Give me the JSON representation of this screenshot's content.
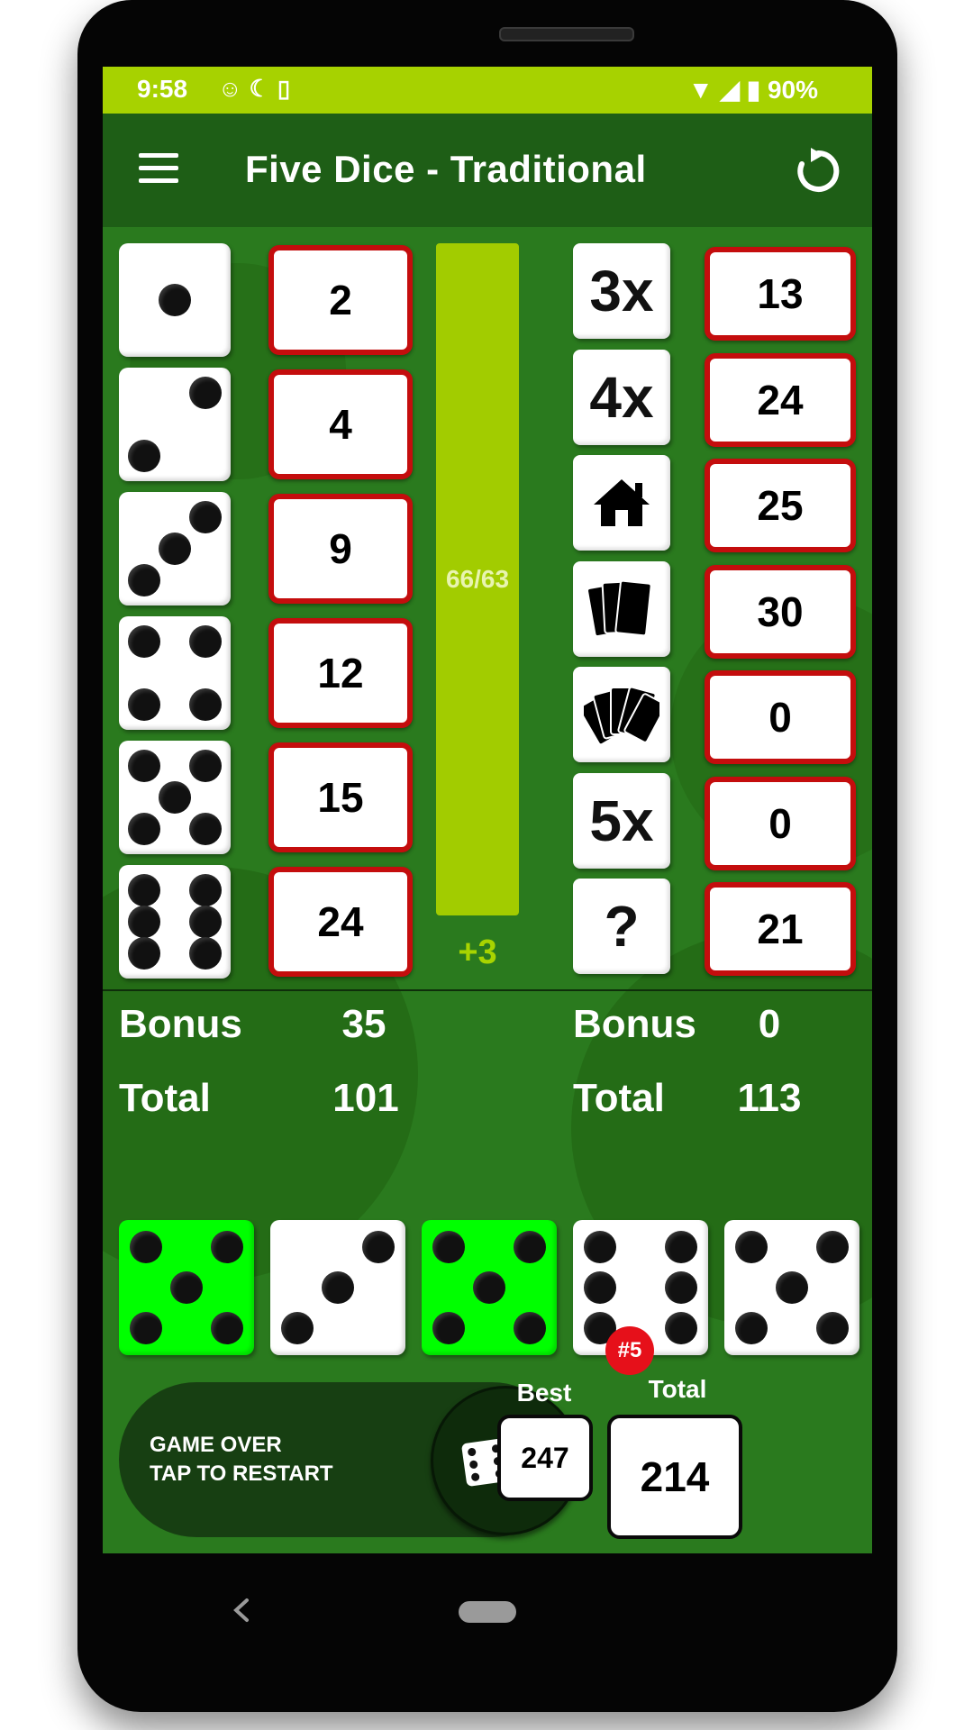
{
  "status_bar": {
    "time": "9:58",
    "icons": [
      "android-head-icon",
      "moon-icon",
      "cast-icon"
    ],
    "battery": "90%",
    "colors": {
      "background": "#a7d200"
    }
  },
  "app_bar": {
    "title": "Five Dice - Traditional",
    "colors": {
      "background": "#1e5e16"
    }
  },
  "upper_section": {
    "rows": [
      {
        "face": 1,
        "score": "2"
      },
      {
        "face": 2,
        "score": "4"
      },
      {
        "face": 3,
        "score": "9"
      },
      {
        "face": 4,
        "score": "12"
      },
      {
        "face": 5,
        "score": "15"
      },
      {
        "face": 6,
        "score": "24"
      }
    ],
    "progress_label": "66/63",
    "progress_fraction": 1.0,
    "bonus_delta": "+3",
    "bonus_label": "Bonus",
    "bonus_value": "35",
    "total_label": "Total",
    "total_value": "101"
  },
  "lower_section": {
    "rows": [
      {
        "label": "3x",
        "icon": "",
        "score": "13"
      },
      {
        "label": "4x",
        "icon": "",
        "score": "24"
      },
      {
        "label": "",
        "icon": "house-icon",
        "score": "25"
      },
      {
        "label": "",
        "icon": "four-cards-icon",
        "score": "30"
      },
      {
        "label": "",
        "icon": "five-cards-icon",
        "score": "0"
      },
      {
        "label": "5x",
        "icon": "",
        "score": "0"
      },
      {
        "label": "?",
        "icon": "",
        "score": "21"
      }
    ],
    "bonus_label": "Bonus",
    "bonus_value": "0",
    "total_label": "Total",
    "total_value": "113"
  },
  "rolled_dice": [
    {
      "face": 5,
      "held": true
    },
    {
      "face": 3,
      "held": false
    },
    {
      "face": 5,
      "held": true
    },
    {
      "face": 6,
      "held": false
    },
    {
      "face": 5,
      "held": false
    }
  ],
  "controls": {
    "status_line1": "GAME OVER",
    "status_line2": "TAP TO RESTART",
    "best_label": "Best",
    "best_value": "247",
    "total_label": "Total",
    "total_value": "214",
    "rank_badge": "#5"
  },
  "colors": {
    "board": "#2a7a1e",
    "held_die": "#00ff00",
    "score_border": "#c40d0d",
    "progress": "#a2cc00",
    "badge": "#e6101a"
  }
}
